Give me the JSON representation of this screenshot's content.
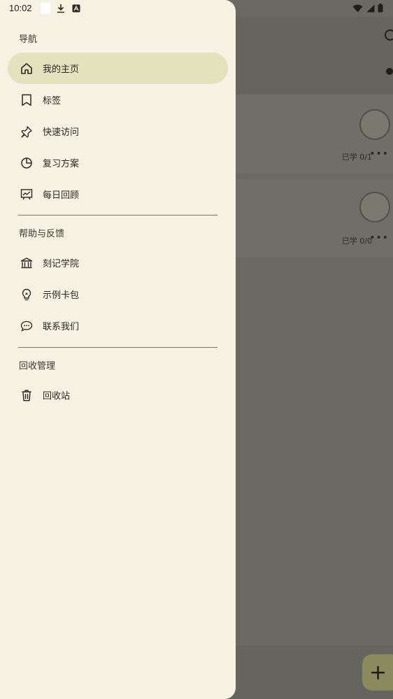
{
  "status_bar": {
    "time": "10:02"
  },
  "drawer": {
    "sections": [
      {
        "title": "导航",
        "items": [
          {
            "label": "我的主页",
            "icon": "home-icon",
            "active": true
          },
          {
            "label": "标签",
            "icon": "bookmark-icon"
          },
          {
            "label": "快速访问",
            "icon": "pin-icon"
          },
          {
            "label": "复习方案",
            "icon": "pie-chart-icon"
          },
          {
            "label": "每日回顾",
            "icon": "trend-chart-icon"
          }
        ]
      },
      {
        "title": "帮助与反馈",
        "items": [
          {
            "label": "刻记学院",
            "icon": "academy-icon"
          },
          {
            "label": "示例卡包",
            "icon": "lightbulb-icon"
          },
          {
            "label": "联系我们",
            "icon": "chat-icon"
          }
        ]
      },
      {
        "title": "回收管理",
        "items": [
          {
            "label": "回收站",
            "icon": "trash-icon"
          }
        ]
      }
    ]
  },
  "background": {
    "cards": [
      {
        "stat": "已学 0/1"
      },
      {
        "stat": "已学 0/0"
      }
    ]
  },
  "colors": {
    "drawer_bg": "#f5f1e3",
    "active_item_bg": "#e4e2bd",
    "scrim": "#6a6963"
  }
}
